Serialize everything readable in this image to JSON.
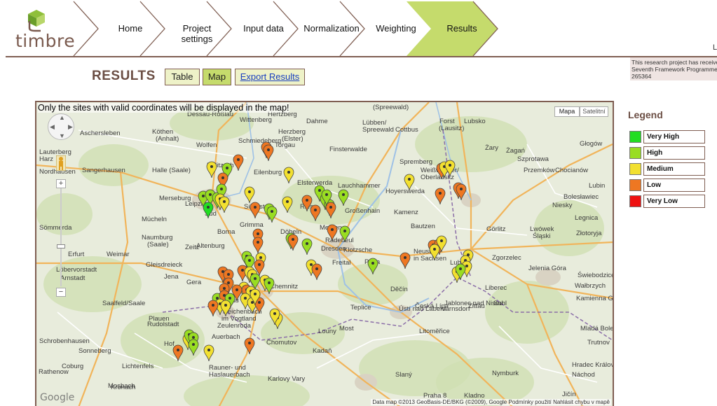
{
  "brand": {
    "logo_text": "timbre"
  },
  "nav": {
    "steps": [
      {
        "label": "Home"
      },
      {
        "label": "Project settings"
      },
      {
        "label": "Input data"
      },
      {
        "label": "Normalization"
      },
      {
        "label": "Weighting"
      },
      {
        "label": "Results",
        "active": true
      }
    ]
  },
  "notice": {
    "line1": "This research project has receive",
    "line2": "Seventh Framework Programme",
    "line3": "265364"
  },
  "edge_text": "L",
  "results": {
    "title": "RESULTS",
    "tabs": {
      "table": "Table",
      "map": "Map",
      "export": "Export Results"
    }
  },
  "map": {
    "note": "Only the sites with valid coordinates will be displayed in the map!",
    "type_map": "Mapa",
    "type_satellite": "Satelitní",
    "google": "Google",
    "attribution": "Data map ©2013 GeoBasis-DE/BKG (©2009), Google   Podmínky použití   Nahlásit chybu v mapě",
    "places": [
      "Dessau-Roßlau",
      "Wittenberg",
      "(Spreewald)",
      "Cottbus",
      "Forst",
      "(Lausitz)",
      "Lubsko",
      "Aschersleben",
      "Köthen",
      "(Anhalt)",
      "Herzberg",
      "(Elster)",
      "Dahme",
      "Lübben/",
      "Spreewald",
      "Wolfen",
      "Schmiedeberg",
      "Torgau",
      "Finsterwalde",
      "Żary",
      "Żagań",
      "Szprotawa",
      "Głogów",
      "Lauterberg",
      "Harz",
      "Nordhausen",
      "Sangerhausen",
      "Halle (Saale)",
      "Delitzsch",
      "Eilenburg",
      "Elsterwerda",
      "Lauchhammer",
      "Spremberg",
      "Weißwasser/",
      "Oberlausitz",
      "Przemków",
      "Chocianów",
      "Lubin",
      "Hoyerswerda",
      "Merseburg",
      "Leipzig",
      "Süd",
      "Südost",
      "Riesa",
      "Großenhain",
      "Niesky",
      "Bolesławiec",
      "Mücheln",
      "Kamenz",
      "Sömmerda",
      "Naumburg",
      "(Saale)",
      "Borna",
      "Grimma",
      "Döbeln",
      "Meißen",
      "Radebeul",
      "Bautzen",
      "Görlitz",
      "Legnica",
      "Lwówek",
      "Śląski",
      "Złotoryja",
      "Zeitz",
      "Altenburg",
      "Weimar",
      "Erfurt",
      "Dresden",
      "Klotzsche",
      "Neustadt",
      "in Sachsen",
      "Lubań",
      "Zgorzelec",
      "Gleisdreieck",
      "Löbervorstadt",
      "Arnstadt",
      "Jena",
      "Gera",
      "Chemnitz",
      "Freital",
      "Pirna",
      "Zittau",
      "Varnsdorf",
      "Liberec",
      "Jelenia Góra",
      "Świebodzice",
      "Wałbrzych",
      "Kamienna Góra",
      "Saalfeld/Saale",
      "Zwickau",
      "Děčín",
      "Teplice",
      "Ústí nad Labem",
      "Česká Lípa",
      "Jablonec nad Nisou",
      "Suhl",
      "Reichenbach",
      "im Vogtland",
      "Plauen",
      "Auerbach",
      "Zeulenroda",
      "Rudolstadt",
      "Louny",
      "Most",
      "Chomutov",
      "Litoměřice",
      "Kadaň",
      "Mladá Boleslav",
      "Hof",
      "Sonneberg",
      "Coburg",
      "Rauner- und",
      "Haslauerbach",
      "Karlovy Vary",
      "Slaný",
      "Praha 8",
      "Hradec Králové",
      "Náchod",
      "Trutnov",
      "Jičín",
      "Nymburk",
      "Kladno",
      "Schrobenhausen",
      "Rathenow",
      "Lichtenfels",
      "Kronach",
      "Mosbach",
      "Hertzberg"
    ]
  },
  "legend": {
    "title": "Legend",
    "items": [
      {
        "label": "Very High",
        "color": "#22dd22"
      },
      {
        "label": "High",
        "color": "#99dd22"
      },
      {
        "label": "Medium",
        "color": "#f2e030"
      },
      {
        "label": "Low",
        "color": "#ee7722"
      },
      {
        "label": "Very Low",
        "color": "#ee1111"
      }
    ]
  }
}
